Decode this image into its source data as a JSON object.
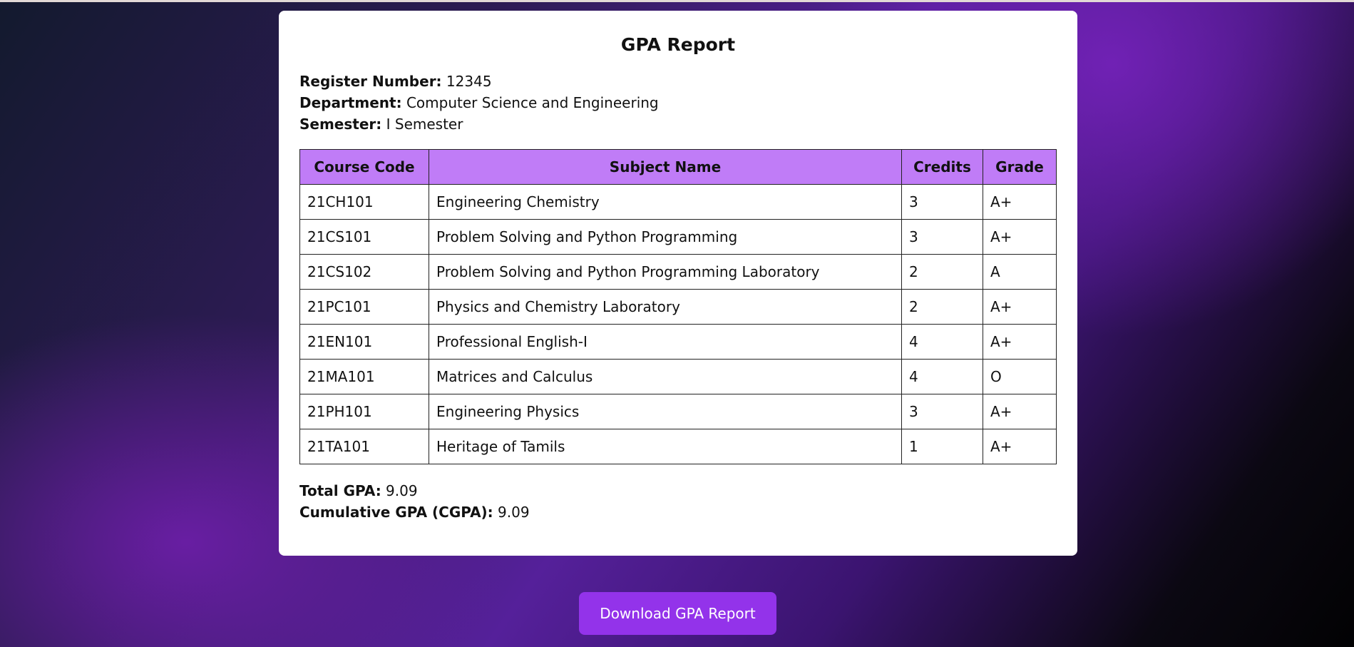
{
  "report": {
    "title": "GPA Report",
    "info": {
      "register_label": "Register Number:",
      "register_value": "12345",
      "department_label": "Department:",
      "department_value": "Computer Science and Engineering",
      "semester_label": "Semester:",
      "semester_value": "I Semester"
    },
    "table": {
      "headers": [
        "Course Code",
        "Subject Name",
        "Credits",
        "Grade"
      ],
      "header_color": "#c07cf7",
      "rows": [
        {
          "code": "21CH101",
          "subject": "Engineering Chemistry",
          "credits": "3",
          "grade": "A+"
        },
        {
          "code": "21CS101",
          "subject": "Problem Solving and Python Programming",
          "credits": "3",
          "grade": "A+"
        },
        {
          "code": "21CS102",
          "subject": "Problem Solving and Python Programming Laboratory",
          "credits": "2",
          "grade": "A"
        },
        {
          "code": "21PC101",
          "subject": "Physics and Chemistry Laboratory",
          "credits": "2",
          "grade": "A+"
        },
        {
          "code": "21EN101",
          "subject": "Professional English-I",
          "credits": "4",
          "grade": "A+"
        },
        {
          "code": "21MA101",
          "subject": "Matrices and Calculus",
          "credits": "4",
          "grade": "O"
        },
        {
          "code": "21PH101",
          "subject": "Engineering Physics",
          "credits": "3",
          "grade": "A+"
        },
        {
          "code": "21TA101",
          "subject": "Heritage of Tamils",
          "credits": "1",
          "grade": "A+"
        }
      ]
    },
    "totals": {
      "gpa_label": "Total GPA:",
      "gpa_value": "9.09",
      "cgpa_label": "Cumulative GPA (CGPA):",
      "cgpa_value": "9.09"
    }
  },
  "actions": {
    "download_label": "Download GPA Report",
    "button_color": "#9333ea"
  }
}
